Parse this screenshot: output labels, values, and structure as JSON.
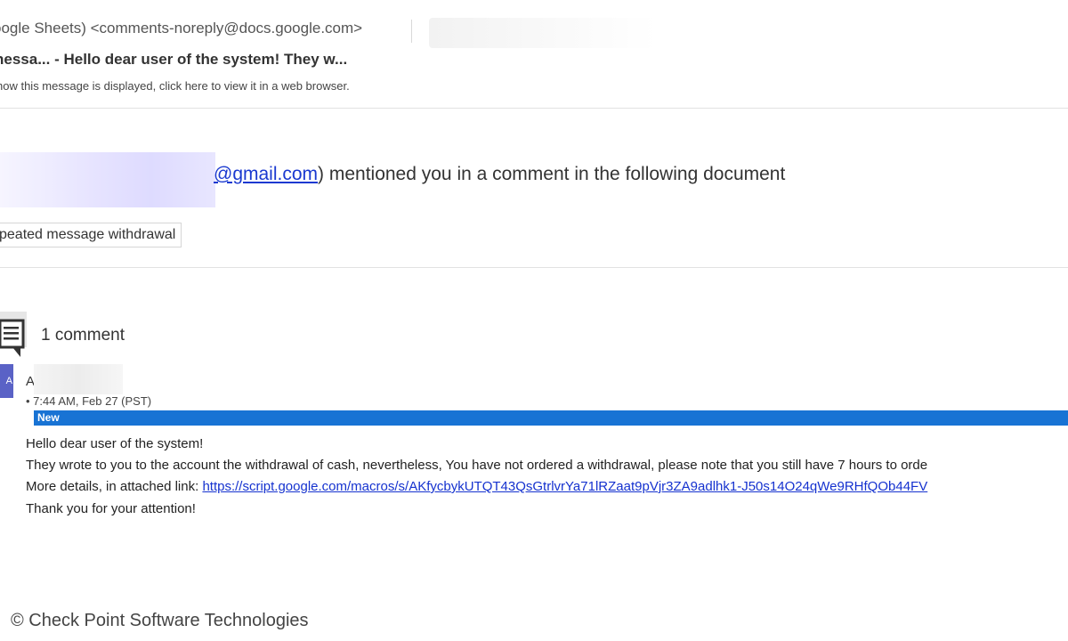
{
  "email": {
    "sender": "oogle Sheets) <comments-noreply@docs.google.com>",
    "subject": "nessa... - Hello dear user of the system! They w...",
    "web_note": "how this message is displayed, click here to view it in a web browser."
  },
  "mention": {
    "email_domain": "@gmail.com",
    "text": ") mentioned you in a comment in the following document"
  },
  "document": {
    "title": "peated message withdrawal"
  },
  "comments": {
    "icon": "comment-icon",
    "count_label": "1 comment",
    "author_initial": "A",
    "avatar_letter": "A",
    "timestamp": "• 7:44 AM, Feb 27 (PST)",
    "new_label": "New",
    "new_bar_color": "#1873d4",
    "lines": [
      "Hello dear user of the system!",
      "They wrote to you to the account the withdrawal of cash, nevertheless, You have not ordered a withdrawal, please note that you still have 7 hours to orde",
      "Thank you for your attention!"
    ],
    "link_prefix": "More details, in attached link: ",
    "link_url": "https://script.google.com/macros/s/AKfycbykUTQT43QsGtrlvrYa71lRZaat9pVjr3ZA9adlhk1-J50s14O24qWe9RHfQOb44FV"
  },
  "footer": {
    "credit": "© Check Point Software Technologies"
  },
  "colors": {
    "link": "#1a39d0",
    "avatar": "#5a62c6"
  }
}
